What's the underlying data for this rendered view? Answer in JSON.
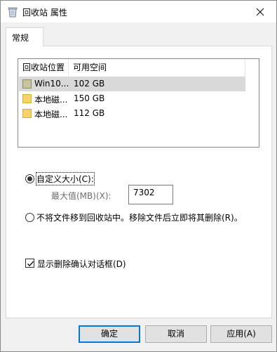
{
  "window": {
    "title": "回收站 属性",
    "icon": "recycle-bin-icon"
  },
  "tabs": [
    {
      "label": "常规",
      "selected": true
    }
  ],
  "locations": {
    "columns": [
      "回收站位置",
      "可用空间"
    ],
    "rows": [
      {
        "name": "Win10...",
        "space": "102 GB",
        "selected": true,
        "icon": "system-drive-icon"
      },
      {
        "name": "本地磁...",
        "space": "150 GB",
        "selected": false,
        "icon": "drive-folder-icon"
      },
      {
        "name": "本地磁...",
        "space": "112 GB",
        "selected": false,
        "icon": "drive-folder-icon"
      }
    ]
  },
  "settings": {
    "custom_size_label": "自定义大小(C):",
    "custom_size_selected": true,
    "max_size_label": "最大值(MB)(X):",
    "max_size_value": "7302",
    "no_move_label": "不将文件移到回收站中。移除文件后立即将其删除(R)。",
    "no_move_selected": false,
    "confirm_label": "显示删除确认对话框(D)",
    "confirm_checked": true
  },
  "buttons": {
    "ok": "确定",
    "cancel": "取消",
    "apply": "应用(A)"
  },
  "colors": {
    "accent": "#0078d7",
    "selection": "#d9d9d9",
    "folder": "#f7d26a",
    "system_drive": "#c8c49c"
  }
}
